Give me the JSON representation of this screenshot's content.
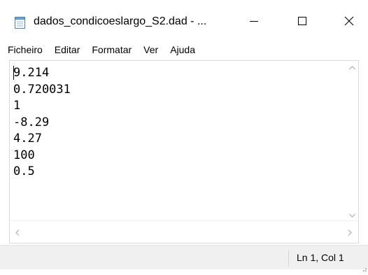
{
  "window": {
    "title": "dados_condicoeslargo_S2.dad - ...",
    "app_icon": "notepad-icon",
    "controls": {
      "minimize_icon": "minimize-icon",
      "maximize_icon": "maximize-icon",
      "close_icon": "close-icon"
    }
  },
  "menu": {
    "items": [
      "Ficheiro",
      "Editar",
      "Formatar",
      "Ver",
      "Ajuda"
    ]
  },
  "editor": {
    "lines": [
      "9.214",
      "0.720031",
      "1",
      "-8.29",
      "4.27",
      "100",
      "0.5"
    ]
  },
  "status": {
    "position": "Ln 1, Col 1"
  },
  "colors": {
    "window_bg": "#ffffff",
    "statusbar_bg": "#f0f0f0",
    "border": "#d9d9d9",
    "scroll_arrow": "#a6a6a6"
  }
}
